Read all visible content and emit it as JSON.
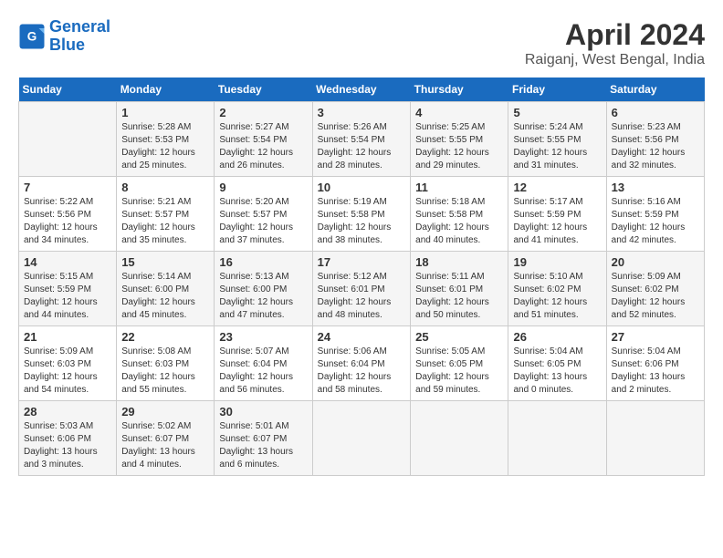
{
  "logo": {
    "line1": "General",
    "line2": "Blue"
  },
  "title": "April 2024",
  "location": "Raiganj, West Bengal, India",
  "weekdays": [
    "Sunday",
    "Monday",
    "Tuesday",
    "Wednesday",
    "Thursday",
    "Friday",
    "Saturday"
  ],
  "weeks": [
    [
      {
        "day": "",
        "sunrise": "",
        "sunset": "",
        "daylight": ""
      },
      {
        "day": "1",
        "sunrise": "Sunrise: 5:28 AM",
        "sunset": "Sunset: 5:53 PM",
        "daylight": "Daylight: 12 hours and 25 minutes."
      },
      {
        "day": "2",
        "sunrise": "Sunrise: 5:27 AM",
        "sunset": "Sunset: 5:54 PM",
        "daylight": "Daylight: 12 hours and 26 minutes."
      },
      {
        "day": "3",
        "sunrise": "Sunrise: 5:26 AM",
        "sunset": "Sunset: 5:54 PM",
        "daylight": "Daylight: 12 hours and 28 minutes."
      },
      {
        "day": "4",
        "sunrise": "Sunrise: 5:25 AM",
        "sunset": "Sunset: 5:55 PM",
        "daylight": "Daylight: 12 hours and 29 minutes."
      },
      {
        "day": "5",
        "sunrise": "Sunrise: 5:24 AM",
        "sunset": "Sunset: 5:55 PM",
        "daylight": "Daylight: 12 hours and 31 minutes."
      },
      {
        "day": "6",
        "sunrise": "Sunrise: 5:23 AM",
        "sunset": "Sunset: 5:56 PM",
        "daylight": "Daylight: 12 hours and 32 minutes."
      }
    ],
    [
      {
        "day": "7",
        "sunrise": "Sunrise: 5:22 AM",
        "sunset": "Sunset: 5:56 PM",
        "daylight": "Daylight: 12 hours and 34 minutes."
      },
      {
        "day": "8",
        "sunrise": "Sunrise: 5:21 AM",
        "sunset": "Sunset: 5:57 PM",
        "daylight": "Daylight: 12 hours and 35 minutes."
      },
      {
        "day": "9",
        "sunrise": "Sunrise: 5:20 AM",
        "sunset": "Sunset: 5:57 PM",
        "daylight": "Daylight: 12 hours and 37 minutes."
      },
      {
        "day": "10",
        "sunrise": "Sunrise: 5:19 AM",
        "sunset": "Sunset: 5:58 PM",
        "daylight": "Daylight: 12 hours and 38 minutes."
      },
      {
        "day": "11",
        "sunrise": "Sunrise: 5:18 AM",
        "sunset": "Sunset: 5:58 PM",
        "daylight": "Daylight: 12 hours and 40 minutes."
      },
      {
        "day": "12",
        "sunrise": "Sunrise: 5:17 AM",
        "sunset": "Sunset: 5:59 PM",
        "daylight": "Daylight: 12 hours and 41 minutes."
      },
      {
        "day": "13",
        "sunrise": "Sunrise: 5:16 AM",
        "sunset": "Sunset: 5:59 PM",
        "daylight": "Daylight: 12 hours and 42 minutes."
      }
    ],
    [
      {
        "day": "14",
        "sunrise": "Sunrise: 5:15 AM",
        "sunset": "Sunset: 5:59 PM",
        "daylight": "Daylight: 12 hours and 44 minutes."
      },
      {
        "day": "15",
        "sunrise": "Sunrise: 5:14 AM",
        "sunset": "Sunset: 6:00 PM",
        "daylight": "Daylight: 12 hours and 45 minutes."
      },
      {
        "day": "16",
        "sunrise": "Sunrise: 5:13 AM",
        "sunset": "Sunset: 6:00 PM",
        "daylight": "Daylight: 12 hours and 47 minutes."
      },
      {
        "day": "17",
        "sunrise": "Sunrise: 5:12 AM",
        "sunset": "Sunset: 6:01 PM",
        "daylight": "Daylight: 12 hours and 48 minutes."
      },
      {
        "day": "18",
        "sunrise": "Sunrise: 5:11 AM",
        "sunset": "Sunset: 6:01 PM",
        "daylight": "Daylight: 12 hours and 50 minutes."
      },
      {
        "day": "19",
        "sunrise": "Sunrise: 5:10 AM",
        "sunset": "Sunset: 6:02 PM",
        "daylight": "Daylight: 12 hours and 51 minutes."
      },
      {
        "day": "20",
        "sunrise": "Sunrise: 5:09 AM",
        "sunset": "Sunset: 6:02 PM",
        "daylight": "Daylight: 12 hours and 52 minutes."
      }
    ],
    [
      {
        "day": "21",
        "sunrise": "Sunrise: 5:09 AM",
        "sunset": "Sunset: 6:03 PM",
        "daylight": "Daylight: 12 hours and 54 minutes."
      },
      {
        "day": "22",
        "sunrise": "Sunrise: 5:08 AM",
        "sunset": "Sunset: 6:03 PM",
        "daylight": "Daylight: 12 hours and 55 minutes."
      },
      {
        "day": "23",
        "sunrise": "Sunrise: 5:07 AM",
        "sunset": "Sunset: 6:04 PM",
        "daylight": "Daylight: 12 hours and 56 minutes."
      },
      {
        "day": "24",
        "sunrise": "Sunrise: 5:06 AM",
        "sunset": "Sunset: 6:04 PM",
        "daylight": "Daylight: 12 hours and 58 minutes."
      },
      {
        "day": "25",
        "sunrise": "Sunrise: 5:05 AM",
        "sunset": "Sunset: 6:05 PM",
        "daylight": "Daylight: 12 hours and 59 minutes."
      },
      {
        "day": "26",
        "sunrise": "Sunrise: 5:04 AM",
        "sunset": "Sunset: 6:05 PM",
        "daylight": "Daylight: 13 hours and 0 minutes."
      },
      {
        "day": "27",
        "sunrise": "Sunrise: 5:04 AM",
        "sunset": "Sunset: 6:06 PM",
        "daylight": "Daylight: 13 hours and 2 minutes."
      }
    ],
    [
      {
        "day": "28",
        "sunrise": "Sunrise: 5:03 AM",
        "sunset": "Sunset: 6:06 PM",
        "daylight": "Daylight: 13 hours and 3 minutes."
      },
      {
        "day": "29",
        "sunrise": "Sunrise: 5:02 AM",
        "sunset": "Sunset: 6:07 PM",
        "daylight": "Daylight: 13 hours and 4 minutes."
      },
      {
        "day": "30",
        "sunrise": "Sunrise: 5:01 AM",
        "sunset": "Sunset: 6:07 PM",
        "daylight": "Daylight: 13 hours and 6 minutes."
      },
      {
        "day": "",
        "sunrise": "",
        "sunset": "",
        "daylight": ""
      },
      {
        "day": "",
        "sunrise": "",
        "sunset": "",
        "daylight": ""
      },
      {
        "day": "",
        "sunrise": "",
        "sunset": "",
        "daylight": ""
      },
      {
        "day": "",
        "sunrise": "",
        "sunset": "",
        "daylight": ""
      }
    ]
  ]
}
